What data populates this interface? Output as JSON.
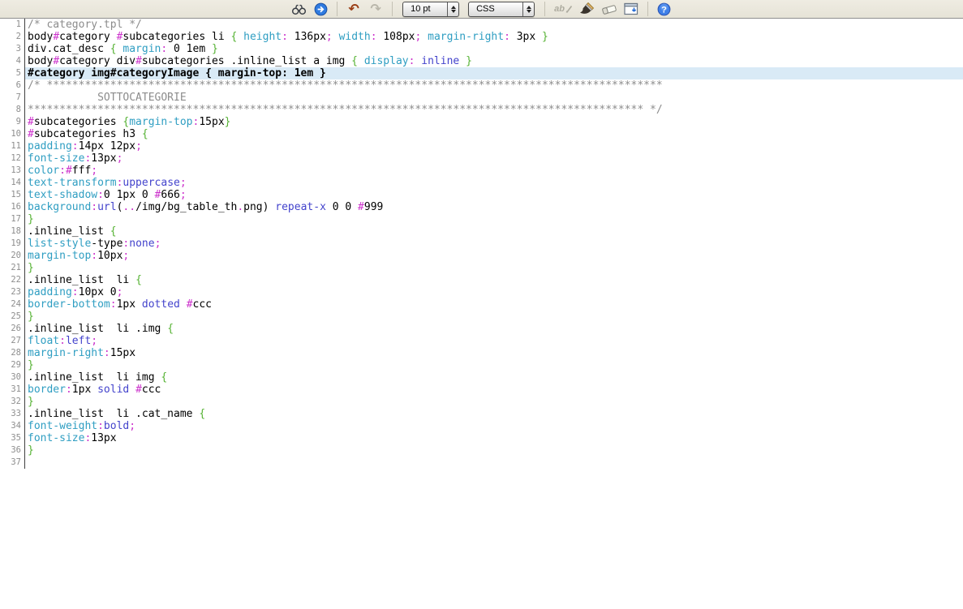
{
  "toolbar": {
    "font_size_value": "10 pt",
    "syntax_value": "CSS",
    "glyphs": {
      "undo": "↶",
      "redo": "↷",
      "spelling": "ab",
      "help": "?"
    },
    "icons": [
      "binoculars-search-icon",
      "go-blue-arrow-icon",
      "undo-icon",
      "redo-icon",
      "font-size-dropdown",
      "syntax-dropdown",
      "spellcheck-icon",
      "brush-icon",
      "eraser-icon",
      "panel-icon",
      "help-icon"
    ]
  },
  "colors": {
    "toolbar_bg": "#e9e6db",
    "highlight_line_bg": "#d9eaf6",
    "comment": "#8c8c8c",
    "property": "#2f9ec2",
    "keyword_value": "#4343cc",
    "punctuation": "#cc33cc",
    "brace": "#55b233",
    "plain_text": "#000000",
    "line_number": "#8e8e8e"
  },
  "editor": {
    "highlighted_line": 5,
    "lines": [
      [
        [
          "c",
          "/* category.tpl */"
        ]
      ],
      [
        [
          "t",
          "body"
        ],
        [
          "m",
          "#"
        ],
        [
          "t",
          "category "
        ],
        [
          "m",
          "#"
        ],
        [
          "t",
          "subcategories li "
        ],
        [
          "b",
          "{"
        ],
        [
          "t",
          " "
        ],
        [
          "p",
          "height"
        ],
        [
          "m",
          ":"
        ],
        [
          "t",
          " 136px"
        ],
        [
          "m",
          ";"
        ],
        [
          "t",
          " "
        ],
        [
          "p",
          "width"
        ],
        [
          "m",
          ":"
        ],
        [
          "t",
          " 108px"
        ],
        [
          "m",
          ";"
        ],
        [
          "t",
          " "
        ],
        [
          "p",
          "margin-right"
        ],
        [
          "m",
          ":"
        ],
        [
          "t",
          " 3px "
        ],
        [
          "b",
          "}"
        ]
      ],
      [
        [
          "t",
          "div.cat_desc "
        ],
        [
          "b",
          "{"
        ],
        [
          "t",
          " "
        ],
        [
          "p",
          "margin"
        ],
        [
          "m",
          ":"
        ],
        [
          "t",
          " 0 1em "
        ],
        [
          "b",
          "}"
        ]
      ],
      [
        [
          "t",
          "body"
        ],
        [
          "m",
          "#"
        ],
        [
          "t",
          "category div"
        ],
        [
          "m",
          "#"
        ],
        [
          "t",
          "subcategories .inline_list a img "
        ],
        [
          "b",
          "{"
        ],
        [
          "t",
          " "
        ],
        [
          "p",
          "display"
        ],
        [
          "m",
          ":"
        ],
        [
          "t",
          " "
        ],
        [
          "k",
          "inline"
        ],
        [
          "t",
          " "
        ],
        [
          "b",
          "}"
        ]
      ],
      [
        [
          "t",
          "#category img#categoryImage { margin-top: 1em }"
        ]
      ],
      [
        [
          "c",
          "/* *************************************************************************************************"
        ]
      ],
      [
        [
          "c",
          "           SOTTOCATEGORIE"
        ]
      ],
      [
        [
          "c",
          "************************************************************************************************* */"
        ]
      ],
      [
        [
          "m",
          "#"
        ],
        [
          "t",
          "subcategories "
        ],
        [
          "b",
          "{"
        ],
        [
          "p",
          "margin-top"
        ],
        [
          "m",
          ":"
        ],
        [
          "t",
          "15px"
        ],
        [
          "b",
          "}"
        ]
      ],
      [
        [
          "m",
          "#"
        ],
        [
          "t",
          "subcategories h3 "
        ],
        [
          "b",
          "{"
        ]
      ],
      [
        [
          "p",
          "padding"
        ],
        [
          "m",
          ":"
        ],
        [
          "t",
          "14px 12px"
        ],
        [
          "m",
          ";"
        ]
      ],
      [
        [
          "p",
          "font-size"
        ],
        [
          "m",
          ":"
        ],
        [
          "t",
          "13px"
        ],
        [
          "m",
          ";"
        ]
      ],
      [
        [
          "p",
          "color"
        ],
        [
          "m",
          ":"
        ],
        [
          "m",
          "#"
        ],
        [
          "t",
          "fff"
        ],
        [
          "m",
          ";"
        ]
      ],
      [
        [
          "p",
          "text-transform"
        ],
        [
          "m",
          ":"
        ],
        [
          "k",
          "uppercase"
        ],
        [
          "m",
          ";"
        ]
      ],
      [
        [
          "p",
          "text-shadow"
        ],
        [
          "m",
          ":"
        ],
        [
          "t",
          "0 1px 0 "
        ],
        [
          "m",
          "#"
        ],
        [
          "t",
          "666"
        ],
        [
          "m",
          ";"
        ]
      ],
      [
        [
          "p",
          "background"
        ],
        [
          "m",
          ":"
        ],
        [
          "k",
          "url"
        ],
        [
          "t",
          "("
        ],
        [
          "m",
          ".."
        ],
        [
          "t",
          "/img/bg_table_th"
        ],
        [
          "m",
          "."
        ],
        [
          "t",
          "png) "
        ],
        [
          "k",
          "repeat-x"
        ],
        [
          "t",
          " 0 0 "
        ],
        [
          "m",
          "#"
        ],
        [
          "t",
          "999"
        ]
      ],
      [
        [
          "b",
          "}"
        ]
      ],
      [
        [
          "t",
          ".inline_list "
        ],
        [
          "b",
          "{"
        ]
      ],
      [
        [
          "p",
          "list-style"
        ],
        [
          "t",
          "-type"
        ],
        [
          "m",
          ":"
        ],
        [
          "k",
          "none"
        ],
        [
          "m",
          ";"
        ]
      ],
      [
        [
          "p",
          "margin-top"
        ],
        [
          "m",
          ":"
        ],
        [
          "t",
          "10px"
        ],
        [
          "m",
          ";"
        ]
      ],
      [
        [
          "b",
          "}"
        ]
      ],
      [
        [
          "t",
          ".inline_list  li "
        ],
        [
          "b",
          "{"
        ]
      ],
      [
        [
          "p",
          "padding"
        ],
        [
          "m",
          ":"
        ],
        [
          "t",
          "10px 0"
        ],
        [
          "m",
          ";"
        ]
      ],
      [
        [
          "p",
          "border-bottom"
        ],
        [
          "m",
          ":"
        ],
        [
          "t",
          "1px "
        ],
        [
          "k",
          "dotted"
        ],
        [
          "t",
          " "
        ],
        [
          "m",
          "#"
        ],
        [
          "t",
          "ccc"
        ]
      ],
      [
        [
          "b",
          "}"
        ]
      ],
      [
        [
          "t",
          ".inline_list  li .img "
        ],
        [
          "b",
          "{"
        ]
      ],
      [
        [
          "p",
          "float"
        ],
        [
          "m",
          ":"
        ],
        [
          "k",
          "left"
        ],
        [
          "m",
          ";"
        ]
      ],
      [
        [
          "p",
          "margin-right"
        ],
        [
          "m",
          ":"
        ],
        [
          "t",
          "15px"
        ]
      ],
      [
        [
          "b",
          "}"
        ]
      ],
      [
        [
          "t",
          ".inline_list  li img "
        ],
        [
          "b",
          "{"
        ]
      ],
      [
        [
          "p",
          "border"
        ],
        [
          "m",
          ":"
        ],
        [
          "t",
          "1px "
        ],
        [
          "k",
          "solid"
        ],
        [
          "t",
          " "
        ],
        [
          "m",
          "#"
        ],
        [
          "t",
          "ccc"
        ]
      ],
      [
        [
          "b",
          "}"
        ]
      ],
      [
        [
          "t",
          ".inline_list  li .cat_name "
        ],
        [
          "b",
          "{"
        ]
      ],
      [
        [
          "p",
          "font-weight"
        ],
        [
          "m",
          ":"
        ],
        [
          "k",
          "bold"
        ],
        [
          "m",
          ";"
        ]
      ],
      [
        [
          "p",
          "font-size"
        ],
        [
          "m",
          ":"
        ],
        [
          "t",
          "13px"
        ]
      ],
      [
        [
          "b",
          "}"
        ]
      ],
      []
    ]
  }
}
